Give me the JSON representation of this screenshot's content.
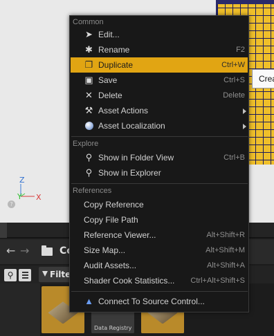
{
  "viewport": {
    "tooltip_text": "Crea",
    "gizmo": {
      "z": "Z",
      "y": "Y",
      "x": "X"
    }
  },
  "content_browser": {
    "breadcrumb": "Co",
    "filter_label": "Filter",
    "tiles": [
      {
        "label": ""
      },
      {
        "label": "Data Registry"
      },
      {
        "label": ""
      }
    ]
  },
  "menu": {
    "sections": [
      {
        "title": "Common"
      },
      {
        "title": "Explore"
      },
      {
        "title": "References"
      }
    ],
    "items": [
      {
        "label": "Edit...",
        "shortcut": "",
        "icon": "edit-icon"
      },
      {
        "label": "Rename",
        "shortcut": "F2",
        "icon": "rename-icon"
      },
      {
        "label": "Duplicate",
        "shortcut": "Ctrl+W",
        "icon": "duplicate-icon",
        "highlighted": true
      },
      {
        "label": "Save",
        "shortcut": "Ctrl+S",
        "icon": "save-icon"
      },
      {
        "label": "Delete",
        "shortcut": "Delete",
        "icon": "delete-icon"
      },
      {
        "label": "Asset Actions",
        "shortcut": "",
        "icon": "wrench-icon",
        "submenu": true
      },
      {
        "label": "Asset Localization",
        "shortcut": "",
        "icon": "globe-icon",
        "submenu": true
      },
      {
        "label": "Show in Folder View",
        "shortcut": "Ctrl+B",
        "icon": "magnifier-icon"
      },
      {
        "label": "Show in Explorer",
        "shortcut": "",
        "icon": "magnifier-icon"
      },
      {
        "label": "Copy Reference",
        "shortcut": ""
      },
      {
        "label": "Copy File Path",
        "shortcut": ""
      },
      {
        "label": "Reference Viewer...",
        "shortcut": "Alt+Shift+R"
      },
      {
        "label": "Size Map...",
        "shortcut": "Alt+Shift+M"
      },
      {
        "label": "Audit Assets...",
        "shortcut": "Alt+Shift+A"
      },
      {
        "label": "Shader Cook Statistics...",
        "shortcut": "Ctrl+Alt+Shift+S"
      },
      {
        "label": "Connect To Source Control...",
        "shortcut": "",
        "icon": "source-control-icon"
      }
    ]
  },
  "colors": {
    "highlight": "#e1a513",
    "menu_bg": "#181818",
    "mesh_yellow": "#efbf2a",
    "mesh_grid": "#1a1a5e"
  }
}
